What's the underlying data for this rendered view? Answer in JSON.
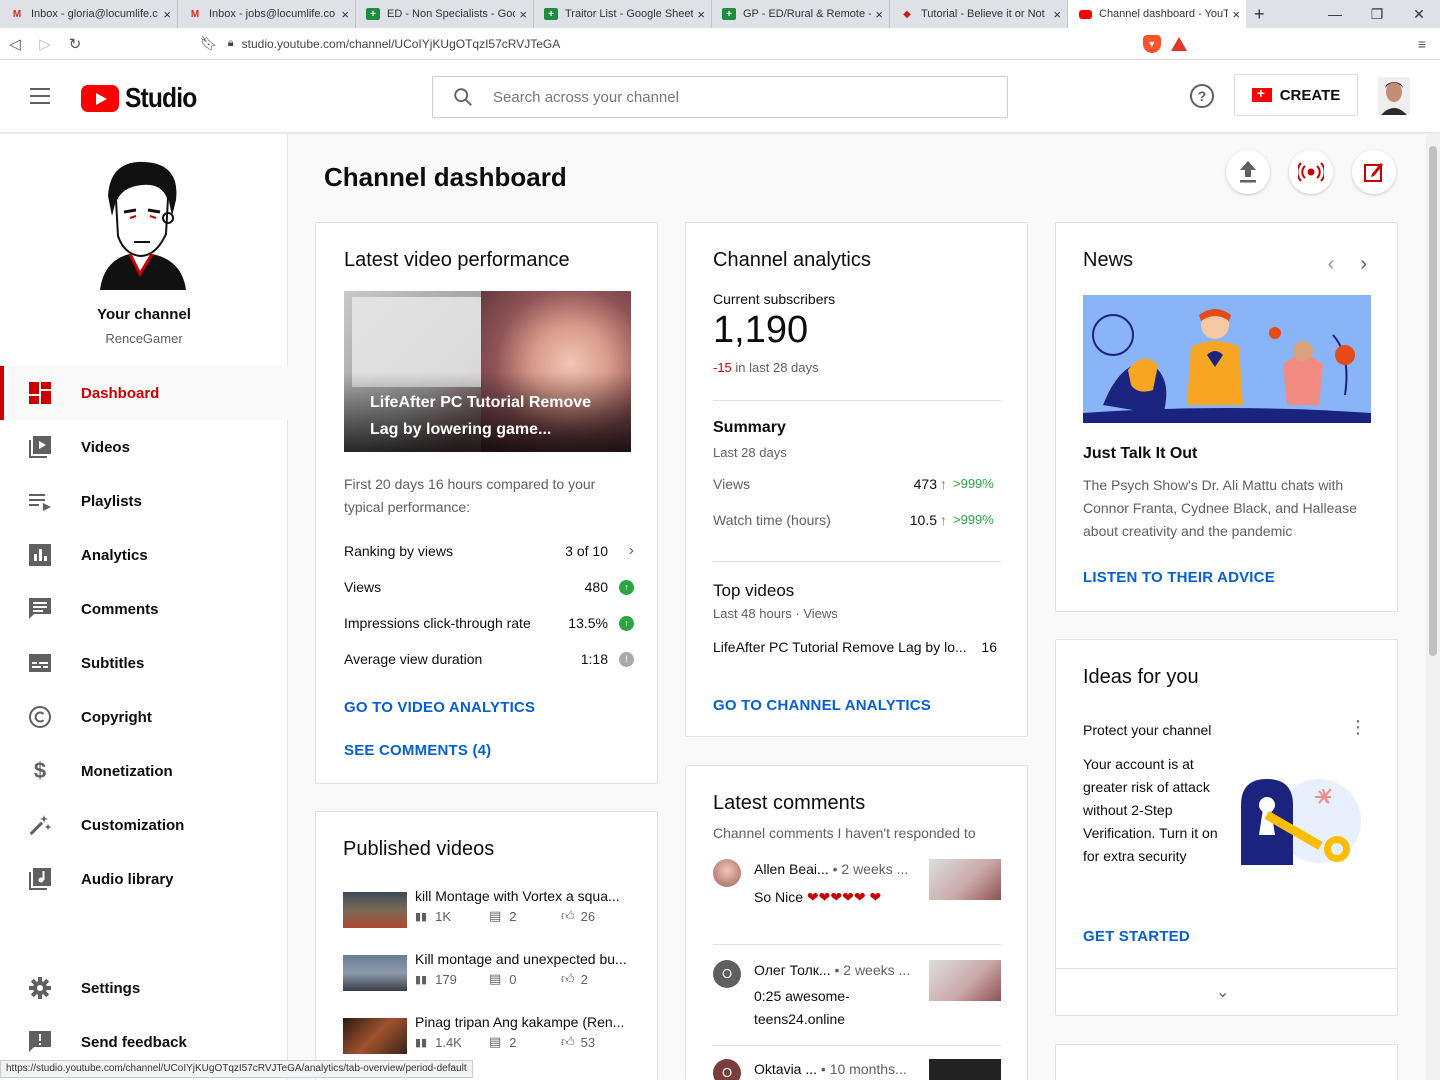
{
  "browser": {
    "tabs": [
      {
        "label": "Inbox - gloria@locumlife.c",
        "icon": "gmail-icon"
      },
      {
        "label": "Inbox - jobs@locumlife.co",
        "icon": "gmail-icon"
      },
      {
        "label": "ED - Non Specialists - Goo",
        "icon": "sheets-icon"
      },
      {
        "label": "Traitor List - Google Sheets",
        "icon": "sheets-icon"
      },
      {
        "label": "GP - ED/Rural & Remote -",
        "icon": "sheets-icon"
      },
      {
        "label": "Tutorial - Believe it or Not",
        "icon": "quiz-icon"
      },
      {
        "label": "Channel dashboard - YouT",
        "icon": "youtube-icon"
      }
    ],
    "url": "studio.youtube.com/channel/UCoIYjKUgOTqzI57cRVJTeGA",
    "status_url": "https://studio.youtube.com/channel/UCoIYjKUgOTqzI57cRVJTeGA/analytics/tab-overview/period-default"
  },
  "header": {
    "logo_text": "Studio",
    "search_placeholder": "Search across your channel",
    "create_label": "CREATE"
  },
  "sidebar": {
    "channel_title": "Your channel",
    "channel_name": "RenceGamer",
    "items": [
      {
        "label": "Dashboard",
        "icon": "dashboard-icon",
        "active": true
      },
      {
        "label": "Videos",
        "icon": "videos-icon"
      },
      {
        "label": "Playlists",
        "icon": "playlists-icon"
      },
      {
        "label": "Analytics",
        "icon": "analytics-icon"
      },
      {
        "label": "Comments",
        "icon": "comments-icon"
      },
      {
        "label": "Subtitles",
        "icon": "subtitles-icon"
      },
      {
        "label": "Copyright",
        "icon": "copyright-icon"
      },
      {
        "label": "Monetization",
        "icon": "dollar-icon"
      },
      {
        "label": "Customization",
        "icon": "magic-wand-icon"
      },
      {
        "label": "Audio library",
        "icon": "audio-library-icon"
      }
    ],
    "bottom": [
      {
        "label": "Settings",
        "icon": "gear-icon"
      },
      {
        "label": "Send feedback",
        "icon": "feedback-icon"
      }
    ]
  },
  "main": {
    "title": "Channel dashboard",
    "latest": {
      "title": "Latest video performance",
      "video_title": "LifeAfter PC Tutorial Remove Lag by lowering game...",
      "desc": "First 20 days 16 hours compared to your typical performance:",
      "rows": [
        {
          "label": "Ranking by views",
          "value": "3 of 10"
        },
        {
          "label": "Views",
          "value": "480"
        },
        {
          "label": "Impressions click-through rate",
          "value": "13.5%"
        },
        {
          "label": "Average view duration",
          "value": "1:18"
        }
      ],
      "link1": "GO TO VIDEO ANALYTICS",
      "link2": "SEE COMMENTS (4)"
    },
    "analytics": {
      "title": "Channel analytics",
      "subs_label": "Current subscribers",
      "subs_value": "1,190",
      "subs_delta": "-15",
      "subs_delta_suffix": " in last 28 days",
      "summary_title": "Summary",
      "summary_sub": "Last 28 days",
      "stats": [
        {
          "label": "Views",
          "value": "473",
          "change": ">999%"
        },
        {
          "label": "Watch time (hours)",
          "value": "10.5",
          "change": ">999%"
        }
      ],
      "top_title": "Top videos",
      "top_sub": "Last 48 hours · Views",
      "top_video": "LifeAfter PC Tutorial Remove Lag by lo...",
      "top_views": "16",
      "link": "GO TO CHANNEL ANALYTICS"
    },
    "news": {
      "title": "News",
      "headline": "Just Talk It Out",
      "body": "The Psych Show's Dr. Ali Mattu chats with Connor Franta, Cydnee Black, and Hallease about creativity and the pandemic",
      "link": "LISTEN TO THEIR ADVICE"
    },
    "ideas": {
      "title": "Ideas for you",
      "subtitle": "Protect your channel",
      "body": "Your account is at greater risk of attack without 2-Step Verification. Turn it on for extra security",
      "link": "GET STARTED"
    },
    "published": {
      "title": "Published videos",
      "videos": [
        {
          "title": "kill Montage with Vortex a squa...",
          "views": "1K",
          "comments": "2",
          "likes": "26"
        },
        {
          "title": "Kill montage and unexpected bu...",
          "views": "179",
          "comments": "0",
          "likes": "2"
        },
        {
          "title": "Pinag tripan Ang kakampe (Ren...",
          "views": "1.4K",
          "comments": "2",
          "likes": "53"
        }
      ]
    },
    "comments": {
      "title": "Latest comments",
      "sub": "Channel comments I haven't responded to",
      "items": [
        {
          "author": "Allen Beai...",
          "time": "• 2 weeks ...",
          "text": "So Nice"
        },
        {
          "author": "Олег Толк...",
          "time": "• 2 weeks ...",
          "text": "0:25 awesome-teens24.online",
          "initial": "О"
        },
        {
          "author": "Oktavia ...",
          "time": "• 10 months...",
          "text": "",
          "initial": "O"
        }
      ]
    }
  },
  "colors": {
    "accent": "#cc0000",
    "link": "#065fd4",
    "positive": "#2ba640",
    "brand": "#ff0000"
  }
}
